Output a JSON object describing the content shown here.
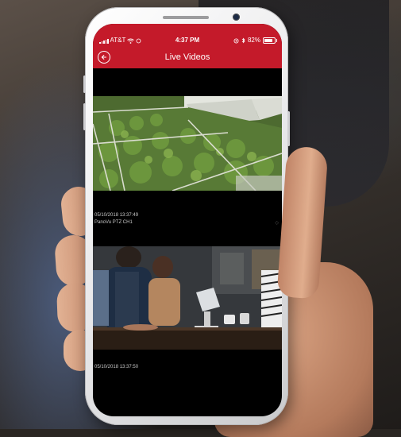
{
  "status_bar": {
    "carrier": "AT&T",
    "time": "4:37 PM",
    "battery": "82%",
    "battery_level": 0.82
  },
  "header": {
    "title": "Live Videos",
    "back_icon": "back-arrow-circle-icon",
    "color": "#c41a2a"
  },
  "videos": [
    {
      "timestamp": "05/10/2018 13:37:49",
      "channel": "PanoVu PTZ CH1",
      "scene": "greenhouse"
    },
    {
      "timestamp": "05/10/2018 13:37:50",
      "channel": "",
      "scene": "cafe"
    }
  ],
  "icons": {
    "wifi": "wifi-icon",
    "signal": "signal-bars-icon",
    "bluetooth": "bluetooth-icon",
    "location": "location-icon",
    "battery": "battery-icon"
  }
}
